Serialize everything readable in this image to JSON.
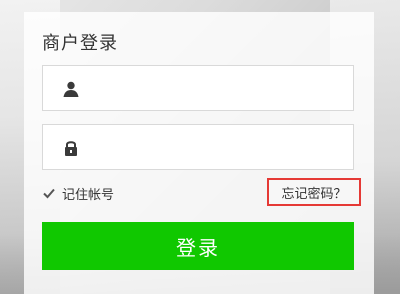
{
  "login": {
    "title": "商户登录",
    "username": {
      "value": "",
      "placeholder": ""
    },
    "password": {
      "value": "",
      "placeholder": ""
    },
    "remember_label": "记住帐号",
    "remember_checked": true,
    "forgot_label": "忘记密码？",
    "submit_label": "登录"
  },
  "icons": {
    "username": "user-icon",
    "password": "lock-icon",
    "remember": "check-icon"
  },
  "colors": {
    "primary_button": "#10c800",
    "highlight_border": "#e53935"
  }
}
